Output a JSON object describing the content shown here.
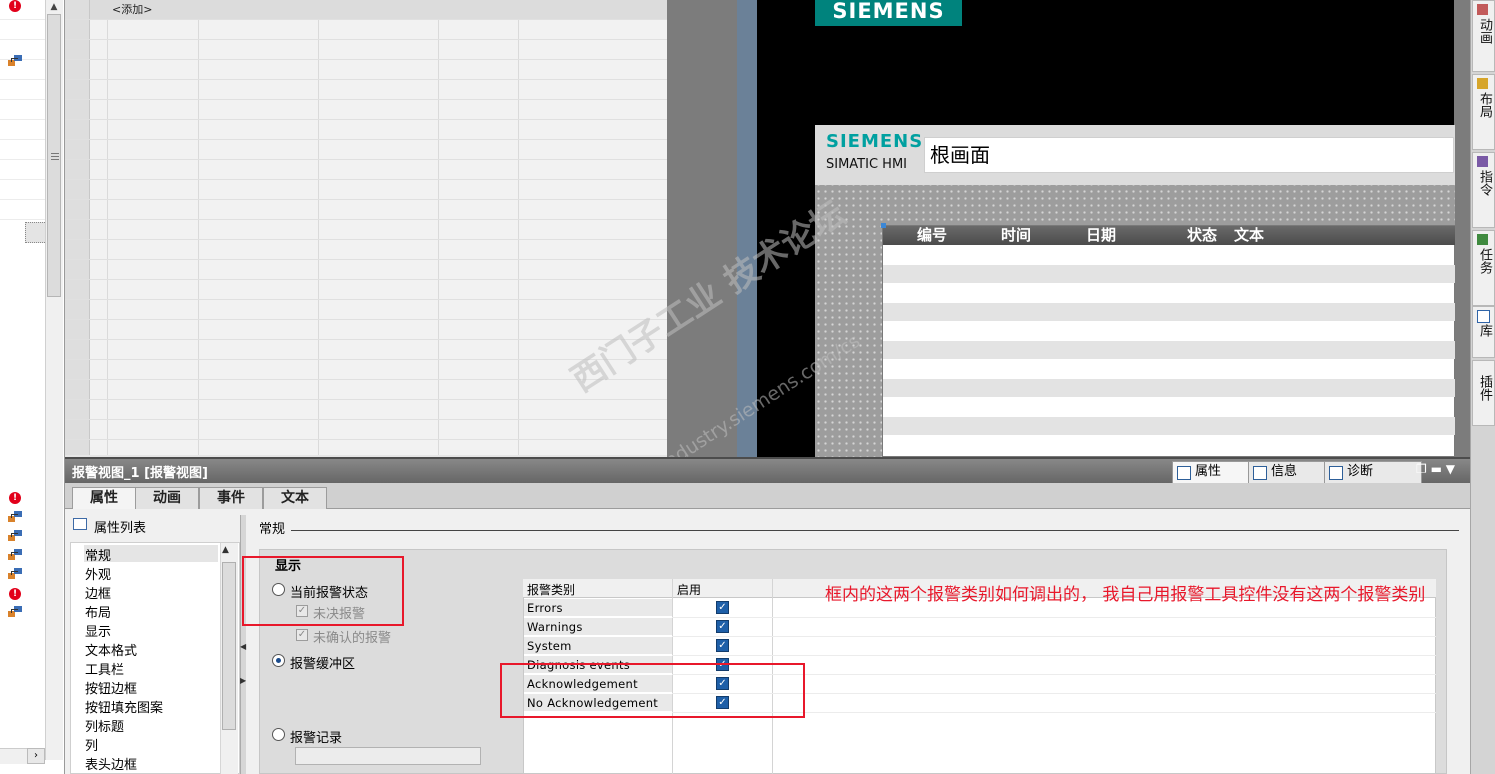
{
  "tag_table": {
    "add_row": "<添加>"
  },
  "canvas": {
    "logo_top": "SIEMENS",
    "logo": "SIEMENS",
    "product": "SIMATIC HMI",
    "screen_title": "根画面",
    "alarm_view_columns": [
      "编号",
      "时间",
      "日期",
      "状态",
      "文本"
    ]
  },
  "right_toolbar": [
    "动画",
    "布局",
    "指令",
    "任务",
    "库",
    "插件"
  ],
  "inspector": {
    "title": "报警视图_1 [报警视图]",
    "tabs": [
      "属性",
      "信息",
      "诊断"
    ],
    "sub_tabs": [
      "属性",
      "动画",
      "事件",
      "文本"
    ],
    "property_list_title": "属性列表",
    "property_list": [
      "常规",
      "外观",
      "边框",
      "布局",
      "显示",
      "文本格式",
      "工具栏",
      "按钮边框",
      "按钮填充图案",
      "列标题",
      "列",
      "表头边框"
    ],
    "selected_property": "常规",
    "section_title": "常规",
    "display": {
      "label": "显示",
      "current_alarm_state": "当前报警状态",
      "pending_alarms": "未决报警",
      "unacknowledged_alarms": "未确认的报警",
      "alarm_buffer": "报警缓冲区",
      "alarm_log": "报警记录",
      "selected": "报警缓冲区"
    },
    "alarm_class_table": {
      "headers": [
        "报警类别",
        "启用"
      ],
      "rows": [
        {
          "name": "Errors",
          "enabled": true
        },
        {
          "name": "Warnings",
          "enabled": true
        },
        {
          "name": "System",
          "enabled": true
        },
        {
          "name": "Diagnosis events",
          "enabled": true
        },
        {
          "name": "Acknowledgement",
          "enabled": true
        },
        {
          "name": "No Acknowledgement",
          "enabled": true
        }
      ]
    }
  },
  "annotation": {
    "note": "框内的这两个报警类别如何调出的， 我自己用报警工具控件没有这两个报警类别",
    "color": "#e8182b"
  },
  "watermark": {
    "line1": "西门子工业 技术论坛",
    "line2": "support.industry.siemens.com/cs"
  },
  "colors": {
    "siemens_teal": "#00837d",
    "checkbox_blue": "#1e5fa8"
  }
}
